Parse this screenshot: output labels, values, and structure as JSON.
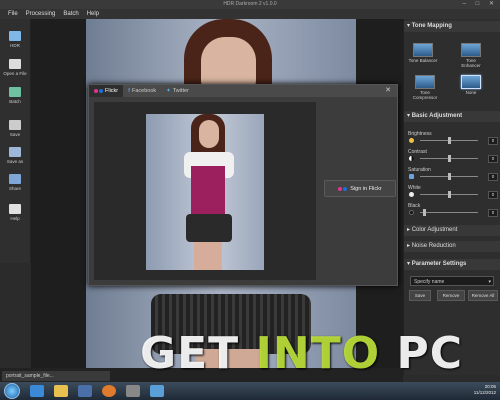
{
  "window": {
    "title": "HDR Darkroom 2 v1.0.0",
    "controls": "– □ ✕"
  },
  "menu": [
    "File",
    "Processing",
    "Batch",
    "Help"
  ],
  "left_toolbar": [
    {
      "label": "HDR",
      "icon": "hdr-icon",
      "color": "#7fb8e8"
    },
    {
      "label": "Open a File",
      "icon": "open-file-icon",
      "color": "#dddddd"
    },
    {
      "label": "Batch",
      "icon": "batch-icon",
      "color": "#6fc0a0"
    },
    {
      "label": "Save",
      "icon": "save-icon",
      "color": "#cccccc"
    },
    {
      "label": "Save as",
      "icon": "save-as-icon",
      "color": "#9fb7d8"
    },
    {
      "label": "Share",
      "icon": "share-icon",
      "color": "#7fa6d8"
    },
    {
      "label": "Help",
      "icon": "help-icon",
      "color": "#e0e0e0"
    }
  ],
  "dialog": {
    "tabs": [
      {
        "label": "Flickr",
        "icon": "flickr-icon",
        "active": true
      },
      {
        "label": "Facebook",
        "icon": "facebook-icon",
        "active": false
      },
      {
        "label": "Twitter",
        "icon": "twitter-icon",
        "active": false
      }
    ],
    "close": "✕",
    "sign_in_label": "Sign in Flickr"
  },
  "right_panel": {
    "tone_mapping": {
      "title": "Tone Mapping",
      "options": [
        {
          "label": "Tone Balancer",
          "selected": false
        },
        {
          "label": "Tone Enhancer",
          "selected": false
        },
        {
          "label": "Tone Compressor",
          "selected": false
        },
        {
          "label": "None",
          "selected": true
        }
      ]
    },
    "basic_adjustment": {
      "title": "Basic Adjustment",
      "sliders": [
        {
          "label": "Brightness",
          "value": "0",
          "level": 0.5
        },
        {
          "label": "Contrast",
          "value": "0",
          "level": 0.5
        },
        {
          "label": "Saturation",
          "value": "0",
          "level": 0.5
        },
        {
          "label": "White",
          "value": "0",
          "level": 0.5
        },
        {
          "label": "Black",
          "value": "0",
          "level": 0.08
        }
      ]
    },
    "color_adjustment": {
      "title": "Color Adjustment"
    },
    "noise_reduction": {
      "title": "Noise Reduction"
    },
    "parameter_settings": {
      "title": "Parameter Settings",
      "preset": "Specify name",
      "buttons": [
        "Save",
        "Remove",
        "Remove All"
      ]
    }
  },
  "file_tab": "portrait_sample_file...",
  "watermark": {
    "part1": "GET ",
    "part2": "INTO",
    "part3": " PC"
  },
  "taskbar": {
    "time": "20:05",
    "date": "11/12/2012"
  },
  "colors": {
    "accent": "#9c1f5e",
    "watermark_green": "#bee13c",
    "panel": "#2e2e2e"
  }
}
